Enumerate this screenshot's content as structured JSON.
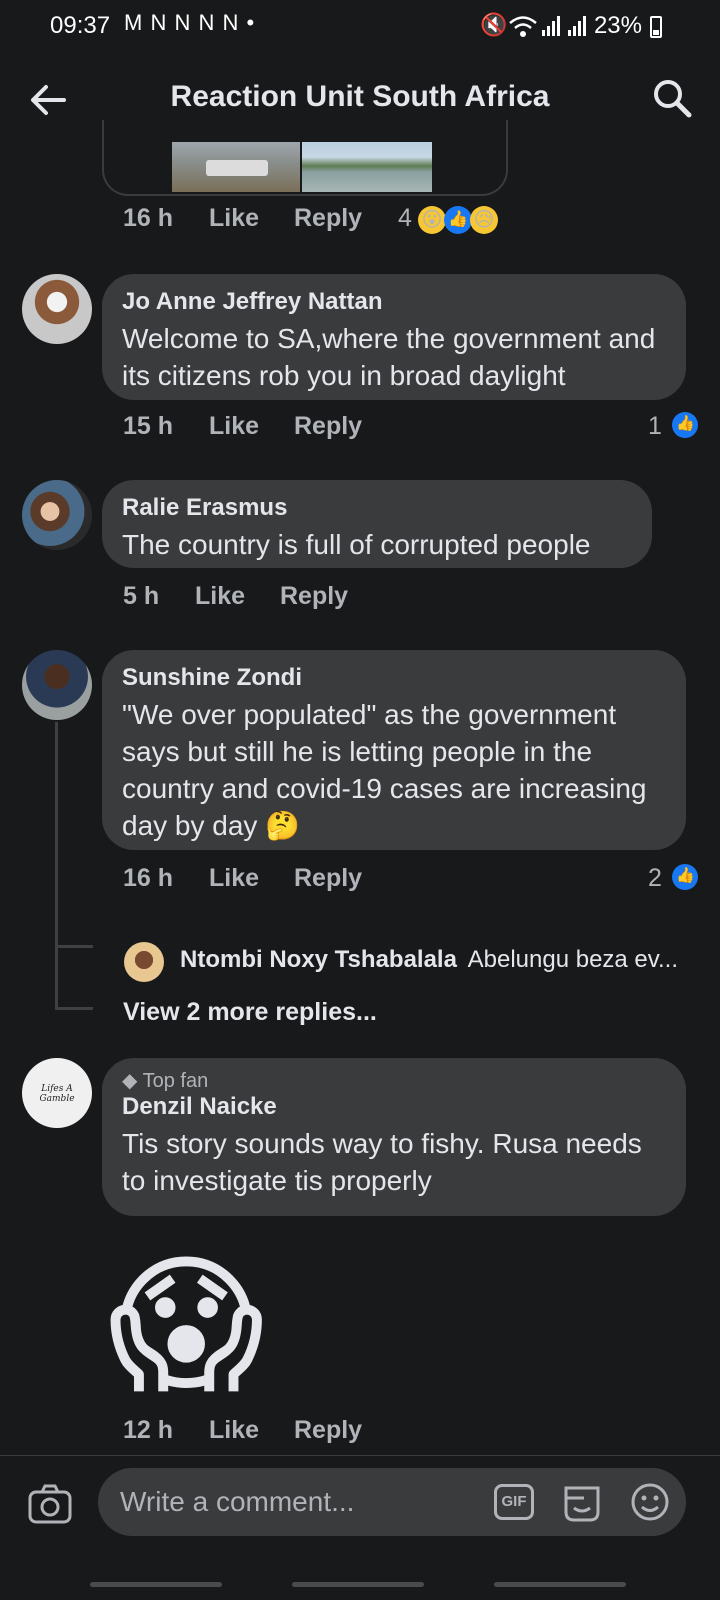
{
  "status_bar": {
    "time": "09:37",
    "notification_icons": "M N N N N •",
    "battery": "23%"
  },
  "header": {
    "title": "Reaction Unit South Africa"
  },
  "top_post": {
    "time": "16 h",
    "like": "Like",
    "reply": "Reply",
    "reaction_count": "4"
  },
  "comments": [
    {
      "author": "Jo Anne Jeffrey Nattan",
      "text": "Welcome to SA,where the government and its citizens rob you in broad daylight",
      "time": "15 h",
      "like": "Like",
      "reply": "Reply",
      "likes": "1"
    },
    {
      "author": "Ralie Erasmus",
      "text": "The country is full of corrupted people",
      "time": "5 h",
      "like": "Like",
      "reply": "Reply"
    },
    {
      "author": "Sunshine Zondi",
      "text": "\"We over populated\" as the government says but still he is letting people in the country and covid-19 cases are increasing day by day 🤔",
      "time": "16 h",
      "like": "Like",
      "reply": "Reply",
      "likes": "2",
      "reply_preview": {
        "author": "Ntombi Noxy Tshabalala",
        "text": "Abelungu beza ev..."
      },
      "more_replies": "View 2 more replies..."
    },
    {
      "badge": "Top fan",
      "author": "Denzil Naicke",
      "text": "Tis story sounds way to fishy. Rusa needs to investigate tis properly",
      "time": "12 h",
      "like": "Like",
      "reply": "Reply",
      "avatar_text": "Lifes A Gamble"
    }
  ],
  "composer": {
    "placeholder": "Write a comment...",
    "gif_label": "GIF"
  },
  "colors": {
    "background": "#18191a",
    "bubble": "#3a3b3c",
    "text": "#e4e6eb",
    "muted": "#b0b3b8",
    "like_blue": "#1877f2"
  }
}
